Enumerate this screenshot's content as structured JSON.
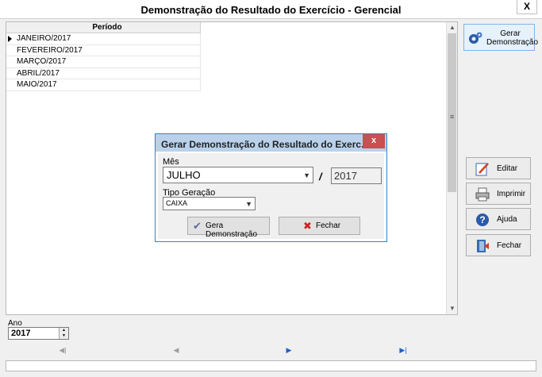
{
  "window": {
    "title": "Demonstração do Resultado do Exercício - Gerencial",
    "close_label": "X"
  },
  "grid": {
    "column_header": "Período",
    "rows": [
      "JANEIRO/2017",
      "FEVEREIRO/2017",
      "MARÇO/2017",
      "ABRIL/2017",
      "MAIO/2017"
    ]
  },
  "ano": {
    "label": "Ano",
    "value": "2017"
  },
  "navigator": {
    "first": "◀|",
    "prior": "◀",
    "next": "▶",
    "last": "▶|"
  },
  "side_buttons": {
    "gerar": "Gerar Demonstração",
    "editar": "Editar",
    "imprimir": "Imprimir",
    "ajuda": "Ajuda",
    "fechar": "Fechar"
  },
  "dialog": {
    "title": "Gerar Demonstração do Resultado do Exerc...",
    "close_label": "x",
    "mes_label": "Mês",
    "mes_value": "JULHO",
    "separator": "/",
    "ano_value": "2017",
    "tipo_label": "Tipo Geração",
    "tipo_value": "CAIXA",
    "gera_button": "Gera Demonstração",
    "fechar_button": "Fechar"
  },
  "colors": {
    "dialog_title_bg": "#b9d1ea",
    "dialog_border": "#2b86d6",
    "close_red": "#c75050",
    "nav_active": "#1e62c8"
  }
}
